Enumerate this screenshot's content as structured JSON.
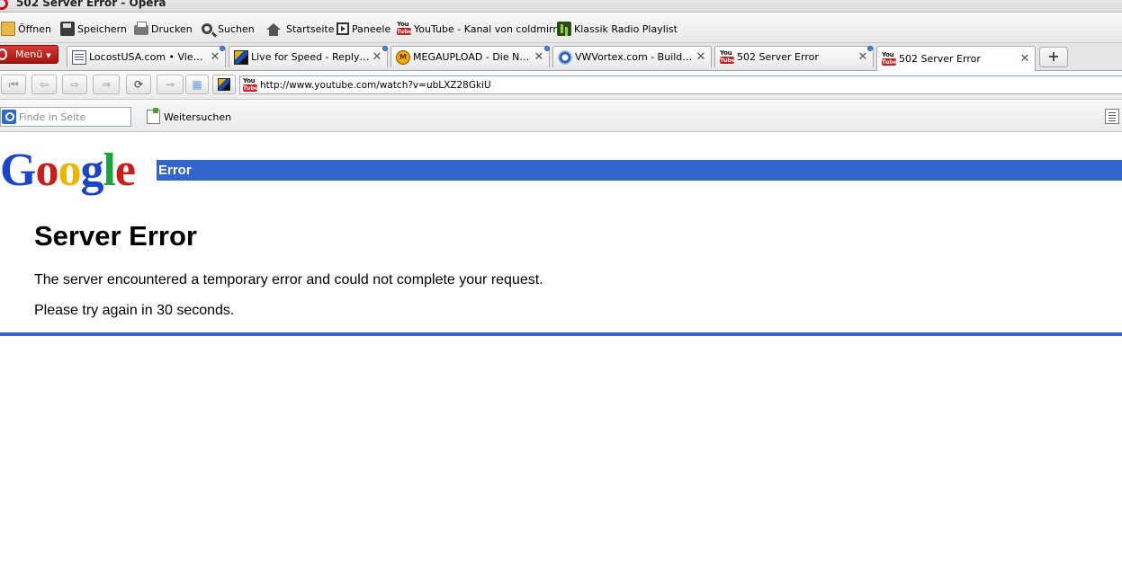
{
  "window": {
    "title": "502 Server Error - Opera"
  },
  "bookmarks": [
    {
      "label": "Öffnen",
      "icon": "folder-icon"
    },
    {
      "label": "Speichern",
      "icon": "save-icon"
    },
    {
      "label": "Drucken",
      "icon": "print-icon"
    },
    {
      "label": "Suchen",
      "icon": "search-icon"
    },
    {
      "label": "Startseite",
      "icon": "home-icon"
    },
    {
      "label": "Paneele",
      "icon": "panels-icon"
    },
    {
      "label": "YouTube - Kanal von coldmirror",
      "icon": "youtube-icon"
    },
    {
      "label": "Klassik Radio Playlist",
      "icon": "radio-icon"
    }
  ],
  "menu": {
    "label": "Menü"
  },
  "tabs": [
    {
      "title": "LocostUSA.com • View t...",
      "icon": "document-icon",
      "active": false
    },
    {
      "title": "Live for Speed - Reply to...",
      "icon": "lfs-icon",
      "active": false
    },
    {
      "title": "MEGAUPLOAD - Die Nr. ...",
      "icon": "megaupload-icon",
      "active": false
    },
    {
      "title": "VWVortex.com - Build: R...",
      "icon": "vwvortex-icon",
      "active": false
    },
    {
      "title": "502 Server Error",
      "icon": "youtube-icon",
      "active": false
    },
    {
      "title": "502 Server Error",
      "icon": "youtube-icon",
      "active": true
    }
  ],
  "address": {
    "url": "http://www.youtube.com/watch?v=ubLXZ28GkiU"
  },
  "find": {
    "placeholder": "Finde in Seite",
    "next_label": "Weitersuchen"
  },
  "page": {
    "logo_letters": [
      "G",
      "o",
      "o",
      "g",
      "l",
      "e"
    ],
    "bar_label": "Error",
    "heading": "Server Error",
    "message": "The server encountered a temporary error and could not complete your request.",
    "retry": "Please try again in 30 seconds."
  },
  "colors": {
    "google_blue": "#3366cc",
    "opera_red": "#cc0f16"
  }
}
